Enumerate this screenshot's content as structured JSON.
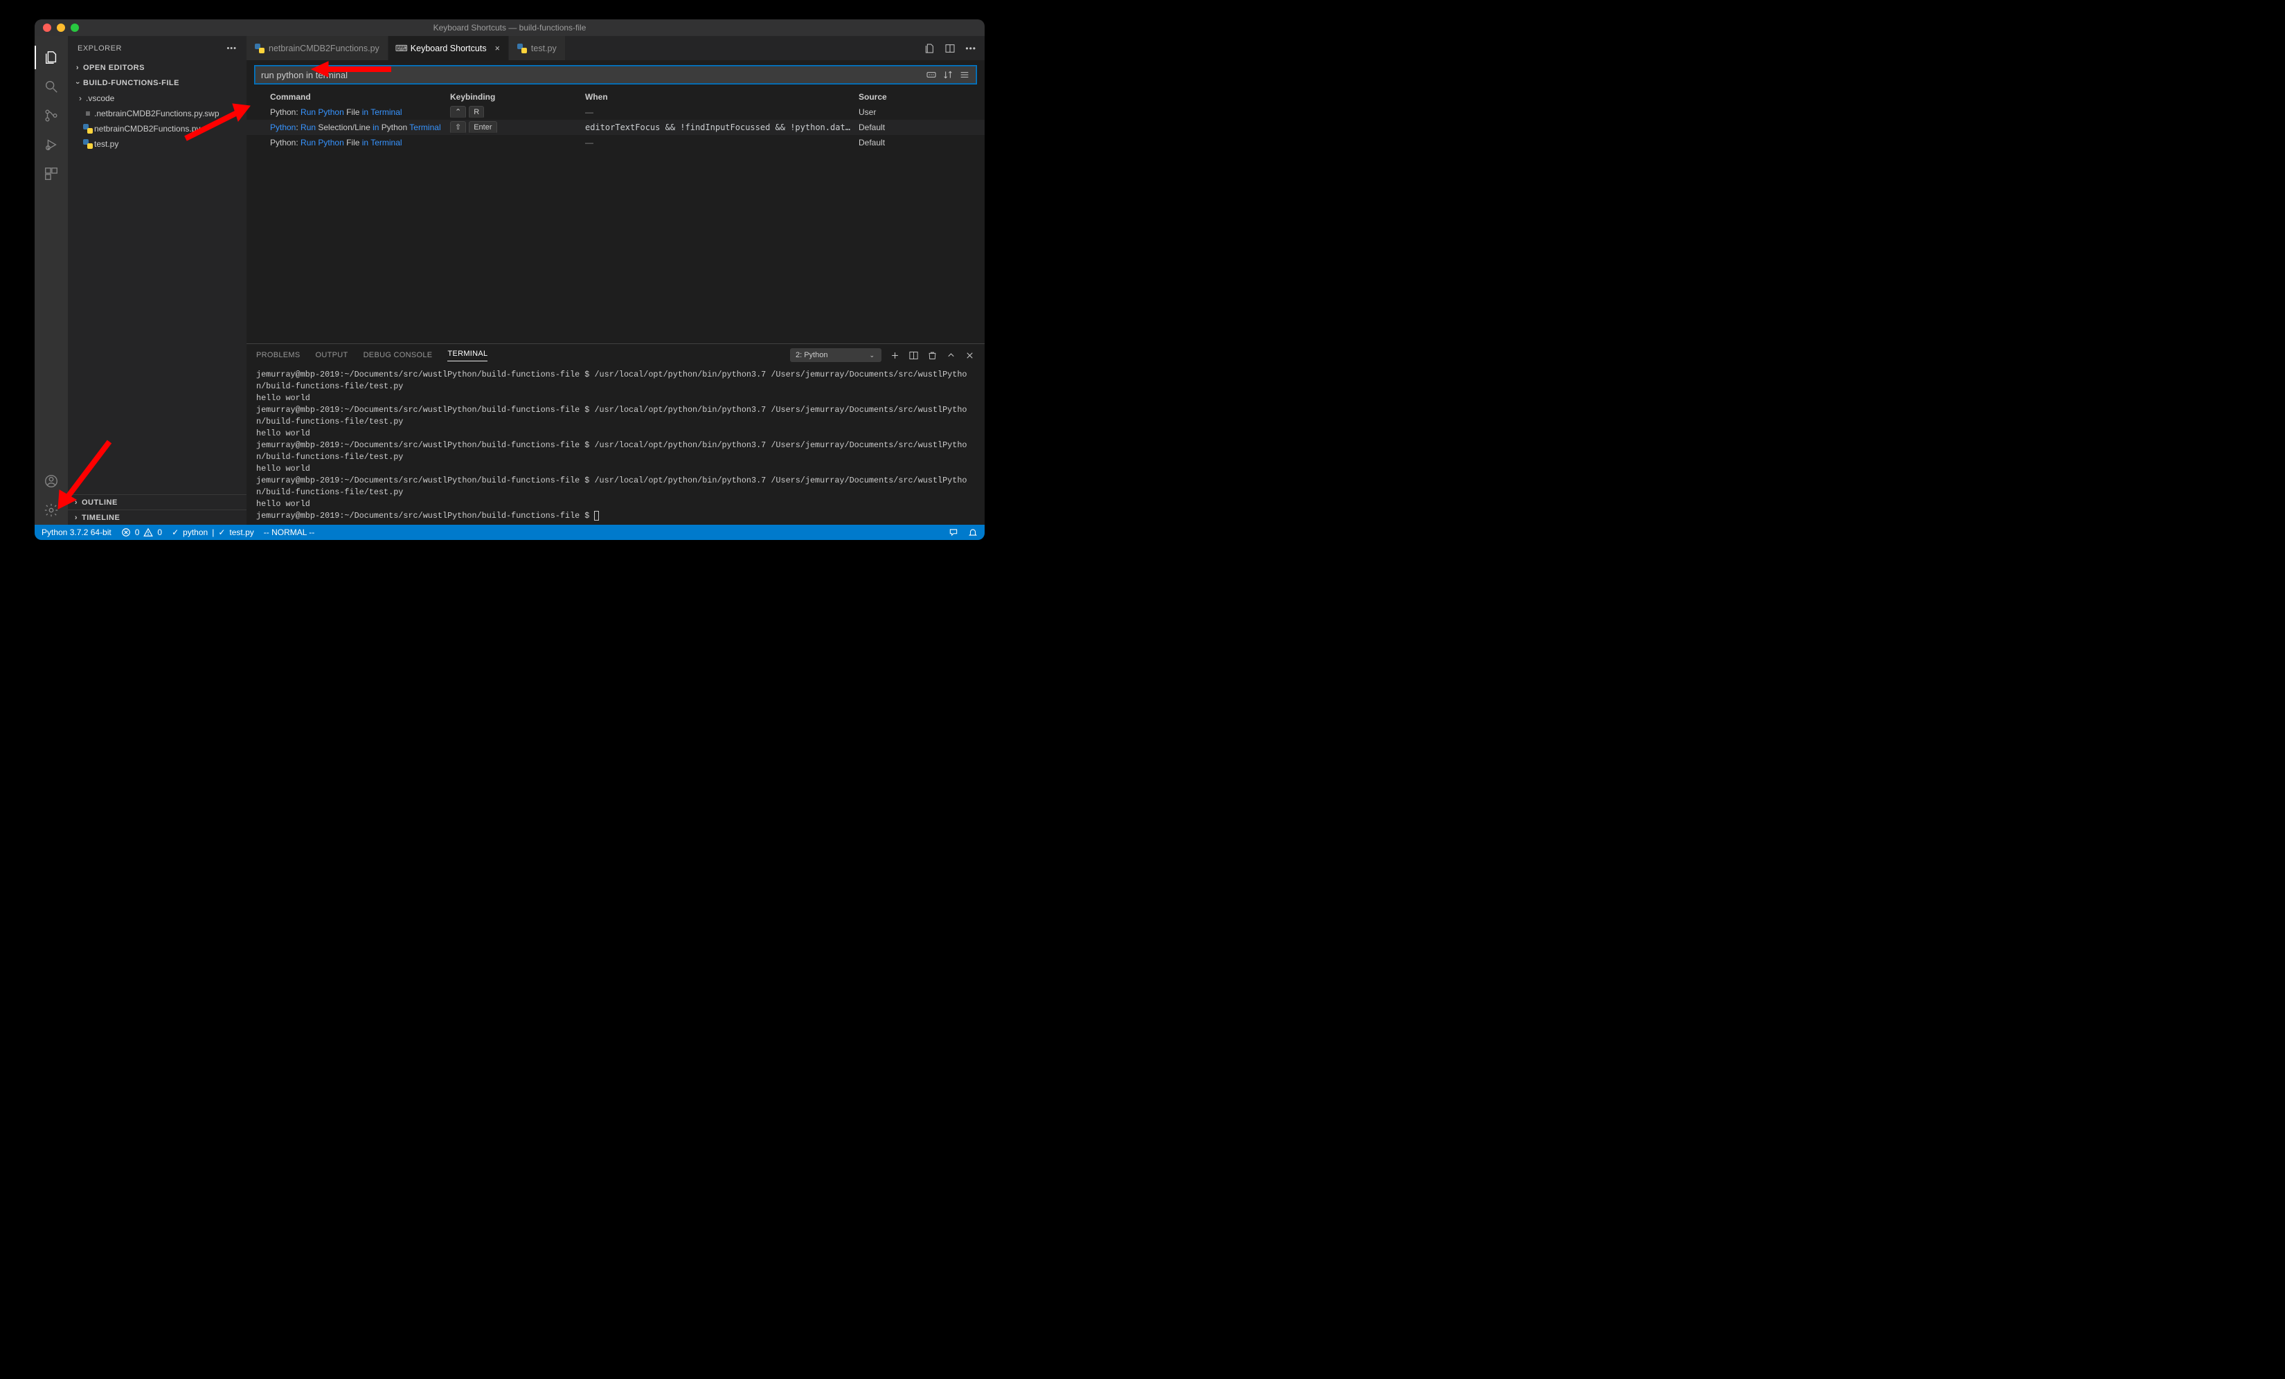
{
  "window": {
    "title": "Keyboard Shortcuts — build-functions-file"
  },
  "sidebar": {
    "title": "EXPLORER",
    "sections": {
      "open_editors": "OPEN EDITORS",
      "folder": "BUILD-FUNCTIONS-FILE",
      "outline": "OUTLINE",
      "timeline": "TIMELINE"
    },
    "files": [
      {
        "label": ".vscode",
        "type": "folder"
      },
      {
        "label": ".netbrainCMDB2Functions.py.swp",
        "type": "file"
      },
      {
        "label": "netbrainCMDB2Functions.py",
        "type": "python"
      },
      {
        "label": "test.py",
        "type": "python"
      }
    ]
  },
  "tabs": [
    {
      "label": "netbrainCMDB2Functions.py",
      "kind": "python",
      "active": false
    },
    {
      "label": "Keyboard Shortcuts",
      "kind": "kb",
      "active": true
    },
    {
      "label": "test.py",
      "kind": "python",
      "active": false
    }
  ],
  "search": {
    "value": "run python in terminal"
  },
  "headers": {
    "command": "Command",
    "keybinding": "Keybinding",
    "when": "When",
    "source": "Source"
  },
  "rows": [
    {
      "command_parts": [
        {
          "t": "Python: ",
          "h": false
        },
        {
          "t": "Run Python",
          "h": true
        },
        {
          "t": " File ",
          "h": false
        },
        {
          "t": "in Terminal",
          "h": true
        }
      ],
      "keys": [
        "⌃",
        "R"
      ],
      "when": "—",
      "when_dash": true,
      "source": "User"
    },
    {
      "command_parts": [
        {
          "t": "Python",
          "h": true
        },
        {
          "t": ": ",
          "h": false
        },
        {
          "t": "Run",
          "h": true
        },
        {
          "t": " Selection/Line ",
          "h": false
        },
        {
          "t": "in",
          "h": true
        },
        {
          "t": " Python ",
          "h": false
        },
        {
          "t": "Terminal",
          "h": true
        }
      ],
      "keys": [
        "⇧",
        "Enter"
      ],
      "when": "editorTextFocus && !findInputFocussed && !python.datascience.own…",
      "when_dash": false,
      "source": "Default"
    },
    {
      "command_parts": [
        {
          "t": "Python: ",
          "h": false
        },
        {
          "t": "Run Python",
          "h": true
        },
        {
          "t": " File ",
          "h": false
        },
        {
          "t": "in Terminal",
          "h": true
        }
      ],
      "keys": [],
      "when": "—",
      "when_dash": true,
      "source": "Default"
    }
  ],
  "panel": {
    "tabs": {
      "problems": "PROBLEMS",
      "output": "OUTPUT",
      "debug": "DEBUG CONSOLE",
      "terminal": "TERMINAL"
    },
    "selector": "2: Python",
    "lines": [
      "jemurray@mbp-2019:~/Documents/src/wustlPython/build-functions-file $ /usr/local/opt/python/bin/python3.7 /Users/jemurray/Documents/src/wustlPython/build-functions-file/test.py",
      "hello world",
      "jemurray@mbp-2019:~/Documents/src/wustlPython/build-functions-file $ /usr/local/opt/python/bin/python3.7 /Users/jemurray/Documents/src/wustlPython/build-functions-file/test.py",
      "hello world",
      "jemurray@mbp-2019:~/Documents/src/wustlPython/build-functions-file $ /usr/local/opt/python/bin/python3.7 /Users/jemurray/Documents/src/wustlPython/build-functions-file/test.py",
      "hello world",
      "jemurray@mbp-2019:~/Documents/src/wustlPython/build-functions-file $ /usr/local/opt/python/bin/python3.7 /Users/jemurray/Documents/src/wustlPython/build-functions-file/test.py",
      "hello world",
      "jemurray@mbp-2019:~/Documents/src/wustlPython/build-functions-file $ "
    ]
  },
  "status": {
    "python": "Python 3.7.2 64-bit",
    "errors": "0",
    "warnings": "0",
    "linter": "python",
    "file": "test.py",
    "mode": "-- NORMAL --"
  }
}
